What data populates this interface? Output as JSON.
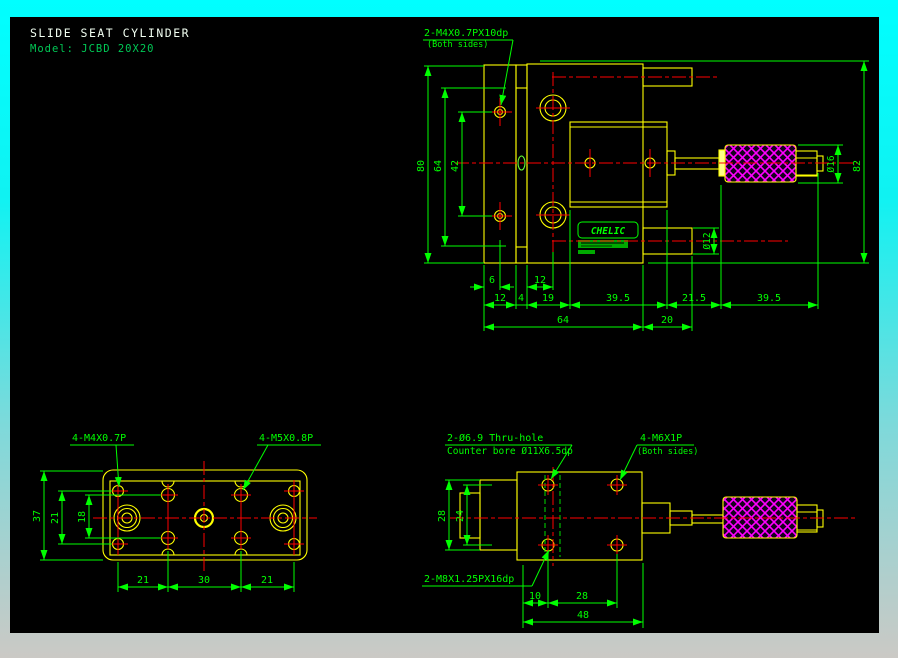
{
  "drawing": {
    "title": "SLIDE SEAT CYLINDER",
    "model_label": "Model: JCBD 20X20",
    "brand": "CHELIC",
    "colors": {
      "canvas": "#000000",
      "geometry": "#ffff00",
      "dimension": "#00ff00",
      "centerline": "#ff0000",
      "knurl": "#ff00ff",
      "frame_top": "#00ffff",
      "frame_bottom": "#cbc9c5",
      "title_text": "#ffffff",
      "model_text": "#00c855"
    },
    "views": {
      "side_view": {
        "callout_thread": "2-M4X0.7PX10dp",
        "callout_thread_note": "(Both sides)",
        "dim_80": "80",
        "dim_64": "64",
        "dim_42": "42",
        "dim_d16": "Ø16",
        "dim_82": "82",
        "dim_d12": "Ø12",
        "dim_6": "6",
        "dim_12a": "12",
        "dim_12b": "12",
        "dim_4": "4",
        "dim_19": "19",
        "dim_39_5a": "39.5",
        "dim_21_5": "21.5",
        "dim_39_5b": "39.5",
        "dim_64b": "64",
        "dim_20": "20"
      },
      "top_view": {
        "callout_m4": "4-M4X0.7P",
        "callout_m5": "4-M5X0.8P",
        "dim_37": "37",
        "dim_21": "21",
        "dim_18": "18",
        "dim_21a": "21",
        "dim_30": "30",
        "dim_21b": "21"
      },
      "front_view": {
        "callout_thru": "2-Ø6.9 Thru-hole",
        "callout_cbore": "Counter bore Ø11X6.5dp",
        "callout_m6": "4-M6X1P",
        "callout_m6_note": "(Both sides)",
        "callout_m8": "2-M8X1.25PX16dp",
        "dim_28": "28",
        "dim_24": "24",
        "dim_10": "10",
        "dim_28b": "28",
        "dim_48": "48"
      }
    }
  }
}
